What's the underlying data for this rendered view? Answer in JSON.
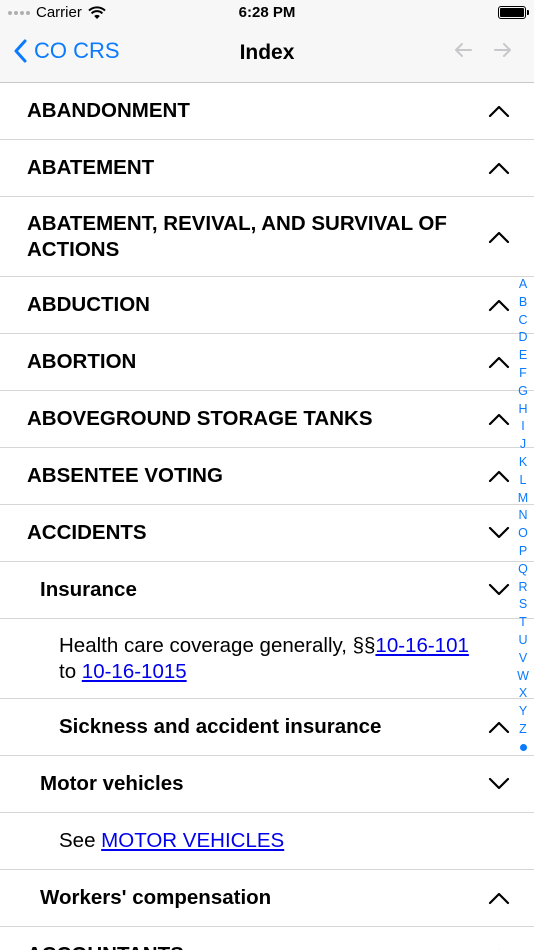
{
  "status": {
    "carrier": "Carrier",
    "time": "6:28 PM"
  },
  "nav": {
    "back_label": "CO CRS",
    "title": "Index"
  },
  "rows": [
    {
      "level": "lvl0",
      "label": "ABANDONMENT",
      "chevron": "up",
      "h": 57
    },
    {
      "level": "lvl0",
      "label": "ABATEMENT",
      "chevron": "up",
      "h": 57
    },
    {
      "level": "lvl0",
      "label": "ABATEMENT, REVIVAL, AND SURVIVAL OF ACTIONS",
      "chevron": "up",
      "h": 80
    },
    {
      "level": "lvl0",
      "label": "ABDUCTION",
      "chevron": "up",
      "h": 57
    },
    {
      "level": "lvl0",
      "label": "ABORTION",
      "chevron": "up",
      "h": 57
    },
    {
      "level": "lvl0",
      "label": "ABOVEGROUND STORAGE TANKS",
      "chevron": "up",
      "h": 57
    },
    {
      "level": "lvl0",
      "label": "ABSENTEE VOTING",
      "chevron": "up",
      "h": 57
    },
    {
      "level": "lvl0",
      "label": "ACCIDENTS",
      "chevron": "down",
      "h": 57
    },
    {
      "level": "lvl1",
      "label": "Insurance",
      "chevron": "down",
      "h": 57
    },
    {
      "level": "txt",
      "parts": [
        {
          "t": "Health care coverage generally,  §§"
        },
        {
          "t": "10-16-101",
          "link": true
        },
        {
          "t": " to "
        },
        {
          "t": "10-16-1015",
          "link": true
        }
      ],
      "h": 80
    },
    {
      "level": "lvl2",
      "label": "Sickness and accident insurance",
      "chevron": "up",
      "h": 57
    },
    {
      "level": "lvl1",
      "label": "Motor vehicles",
      "chevron": "down",
      "h": 57
    },
    {
      "level": "txt",
      "parts": [
        {
          "t": "See "
        },
        {
          "t": "MOTOR VEHICLES",
          "link": true
        }
      ],
      "h": 57
    },
    {
      "level": "lvl1",
      "label": "Workers' compensation",
      "chevron": "up",
      "h": 57
    },
    {
      "level": "lvl0",
      "label": "ACCOUNTANTS",
      "chevron": "up",
      "h": 57
    }
  ],
  "alphabet": [
    "A",
    "B",
    "C",
    "D",
    "E",
    "F",
    "G",
    "H",
    "I",
    "J",
    "K",
    "L",
    "M",
    "N",
    "O",
    "P",
    "Q",
    "R",
    "S",
    "T",
    "U",
    "V",
    "W",
    "X",
    "Y",
    "Z"
  ],
  "colors": {
    "accent": "#0a7aff",
    "link": "#0000ee",
    "separator": "#d6d6d6"
  }
}
